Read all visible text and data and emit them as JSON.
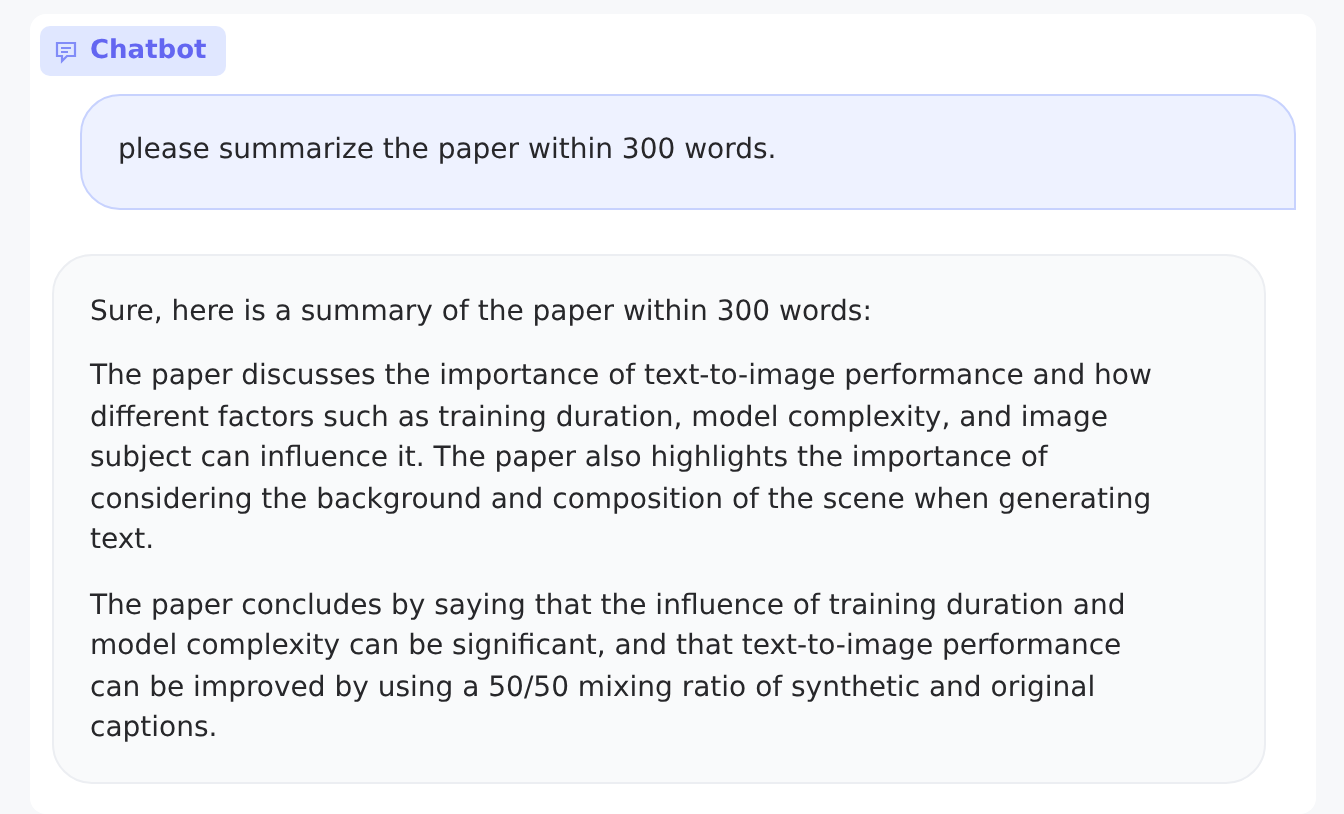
{
  "label": {
    "text": "Chatbot"
  },
  "messages": [
    {
      "kind": "user",
      "paragraphs": [
        "please summarize the paper within 300 words."
      ]
    },
    {
      "kind": "bot",
      "paragraphs": [
        "Sure, here is a summary of the paper within 300 words:",
        "The paper discusses the importance of text-to-image performance and how different factors such as training duration, model complexity, and image subject can influence it. The paper also highlights the importance of considering the background and composition of the scene when generating text.",
        "The paper concludes by saying that the influence of training duration and model complexity can be significant, and that text-to-image performance can be improved by using a 50/50 mixing ratio of synthetic and original captions."
      ]
    }
  ]
}
